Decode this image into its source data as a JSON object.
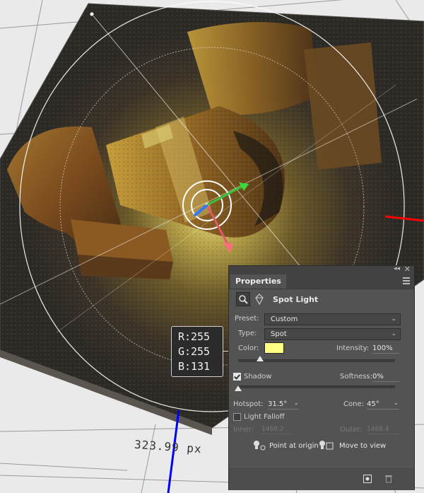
{
  "viewport": {
    "measurement_label": "323.99 px"
  },
  "color_tooltip": {
    "r_label": "R:",
    "r": "255",
    "g_label": "G:",
    "g": "255",
    "b_label": "B:",
    "b": "131"
  },
  "panel": {
    "tab_title": "Properties",
    "light_type_title": "Spot Light",
    "preset": {
      "label": "Preset:",
      "value": "Custom"
    },
    "type": {
      "label": "Type:",
      "value": "Spot"
    },
    "color": {
      "label": "Color:",
      "swatch": "#ffff83"
    },
    "intensity": {
      "label": "Intensity:",
      "value": "100%",
      "slider_fraction": 0.14
    },
    "shadow": {
      "label": "Shadow",
      "checked": true
    },
    "softness": {
      "label": "Softness:",
      "value": "0%",
      "slider_fraction": 0.0
    },
    "hotspot": {
      "label": "Hotspot:",
      "value": "31.5°"
    },
    "cone": {
      "label": "Cone:",
      "value": "45°"
    },
    "light_falloff": {
      "label": "Light Falloff",
      "checked": false
    },
    "inner": {
      "label": "Inner:",
      "value": "1468.2"
    },
    "outer": {
      "label": "Outer:",
      "value": "1468.4"
    },
    "point_at_origin": "Point at origin",
    "move_to_view": "Move to view"
  },
  "colors": {
    "panel_bg": "#535353",
    "swatch": "#ffff83",
    "axis_x": "#ff0000",
    "axis_z": "#0000ff"
  },
  "icons": [
    "spot-light-icon",
    "scene-light-icon",
    "point-at-origin-icon",
    "move-to-view-icon",
    "render-icon",
    "trash-icon",
    "panel-menu-icon",
    "collapse-icon",
    "close-icon"
  ]
}
